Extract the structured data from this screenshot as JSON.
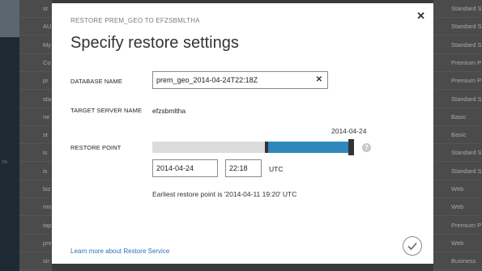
{
  "background": {
    "left_nav_label": "DB",
    "list_rows": [
      "st",
      "AU",
      "My",
      "Co",
      "pr",
      "sta",
      "ne",
      "st",
      "is",
      "is",
      "biz",
      "mo",
      "tap",
      "pre",
      "sir"
    ],
    "editions": [
      "Standard S",
      "Standard S",
      "Standard S",
      "Premium P",
      "Premium P",
      "Standard S",
      "Basic",
      "Basic",
      "Standard S",
      "Standard S",
      "Web",
      "Web",
      "Premium P",
      "Web",
      "Business"
    ]
  },
  "dialog": {
    "subtitle": "RESTORE PREM_GEO TO EFZSBMLTHA",
    "title": "Specify restore settings",
    "close_icon": "close-icon",
    "database_name_label": "DATABASE NAME",
    "database_name_value": "prem_geo_2014-04-24T22:18Z",
    "target_server_label": "TARGET SERVER NAME",
    "target_server_value": "efzsbmltha",
    "restore_point_label": "RESTORE POINT",
    "slider_date": "2014-04-24",
    "slider_position": 0.99,
    "date_value": "2014-04-24",
    "time_value": "22:18",
    "timezone": "UTC",
    "earliest_text": "Earliest restore point is '2014-04-11 19:20' UTC",
    "learn_more": "Learn more about Restore Service",
    "help_glyph": "?",
    "clear_glyph": "✕",
    "close_glyph": "✕",
    "accent_color": "#2e87bd"
  }
}
